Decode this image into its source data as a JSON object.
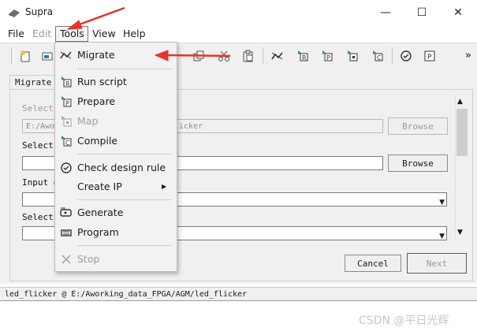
{
  "window": {
    "title": "Supra",
    "minimize": "—",
    "maximize": "☐",
    "close": "✕"
  },
  "menubar": {
    "items": [
      "File",
      "Edit",
      "Tools",
      "View",
      "Help"
    ]
  },
  "toolbar": {
    "overflow": "»"
  },
  "tab": {
    "label": "Migrate"
  },
  "form": {
    "label1": "Select",
    "field1_value": "E:/Awo",
    "field1_tail": "icker",
    "browse1": "Browse",
    "label2": "Select",
    "browse2": "Browse",
    "label3": "Input d",
    "label4": "Select",
    "cancel": "Cancel",
    "next": "Next"
  },
  "status": {
    "text": "led_flicker @ E:/Aworking_data_FPGA/AGM/led_flicker"
  },
  "watermark": "CSDN @平日光辉",
  "tools_menu": {
    "items": [
      {
        "label": "Migrate",
        "icon": "migrate-icon",
        "enabled": true
      },
      {
        "label": "Run script",
        "icon": "run-script-icon",
        "enabled": true
      },
      {
        "label": "Prepare",
        "icon": "prepare-icon",
        "enabled": true
      },
      {
        "label": "Map",
        "icon": "map-icon",
        "enabled": false
      },
      {
        "label": "Compile",
        "icon": "compile-icon",
        "enabled": true
      },
      {
        "label": "Check design rule",
        "icon": "check-icon",
        "enabled": true
      },
      {
        "label": "Create IP",
        "icon": "",
        "enabled": true,
        "submenu": true
      },
      {
        "label": "Generate",
        "icon": "generate-icon",
        "enabled": true
      },
      {
        "label": "Program",
        "icon": "program-icon",
        "enabled": true
      },
      {
        "label": "Stop",
        "icon": "stop-icon",
        "enabled": false
      }
    ],
    "submenu_arrow": "▶"
  },
  "colors": {
    "annotation_arrow": "#e8322d",
    "menu_background": "#f2f2f2",
    "toolbar_background": "#f0f0f0",
    "icon_green": "#2e9e3e"
  }
}
